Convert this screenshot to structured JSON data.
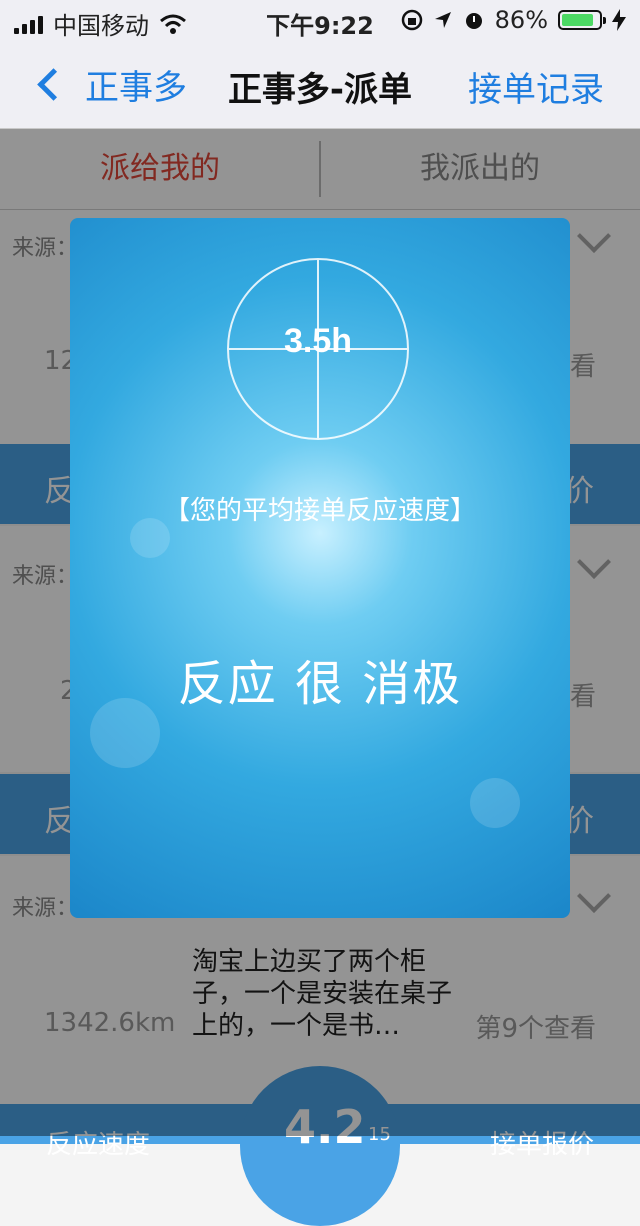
{
  "status_bar": {
    "carrier": "中国移动",
    "time": "下午9:22",
    "battery": "86%",
    "battery_level": 0.86
  },
  "nav": {
    "back_label": "正事多",
    "title": "正事多-派单",
    "right_label": "接单记录"
  },
  "tabs": [
    {
      "label": "派给我的",
      "active": true
    },
    {
      "label": "我派出的",
      "active": false
    }
  ],
  "list": {
    "source_label": "来源：",
    "items": [
      {
        "left_value": "12",
        "right_text": "看",
        "band_left": "反",
        "band_right": "价"
      },
      {
        "left_value": "2",
        "right_text": "看",
        "band_left": "反",
        "band_right": "价"
      },
      {
        "distance": "1342.6km",
        "description": "淘宝上边买了两个柜子，一个是安装在桌子上的，一个是书…",
        "view_text": "第9个查看",
        "band_left": "反应速度",
        "band_center": "4.2",
        "band_small": "15",
        "band_right": "接单报价"
      }
    ]
  },
  "modal": {
    "gauge_value": "3.5h",
    "caption": "【您的平均接单反应速度】",
    "verdict": "反应 很 消极"
  },
  "colors": {
    "accent_blue": "#1f7ee0",
    "active_red": "#e0483a",
    "band_blue": "#4aa3e6"
  }
}
